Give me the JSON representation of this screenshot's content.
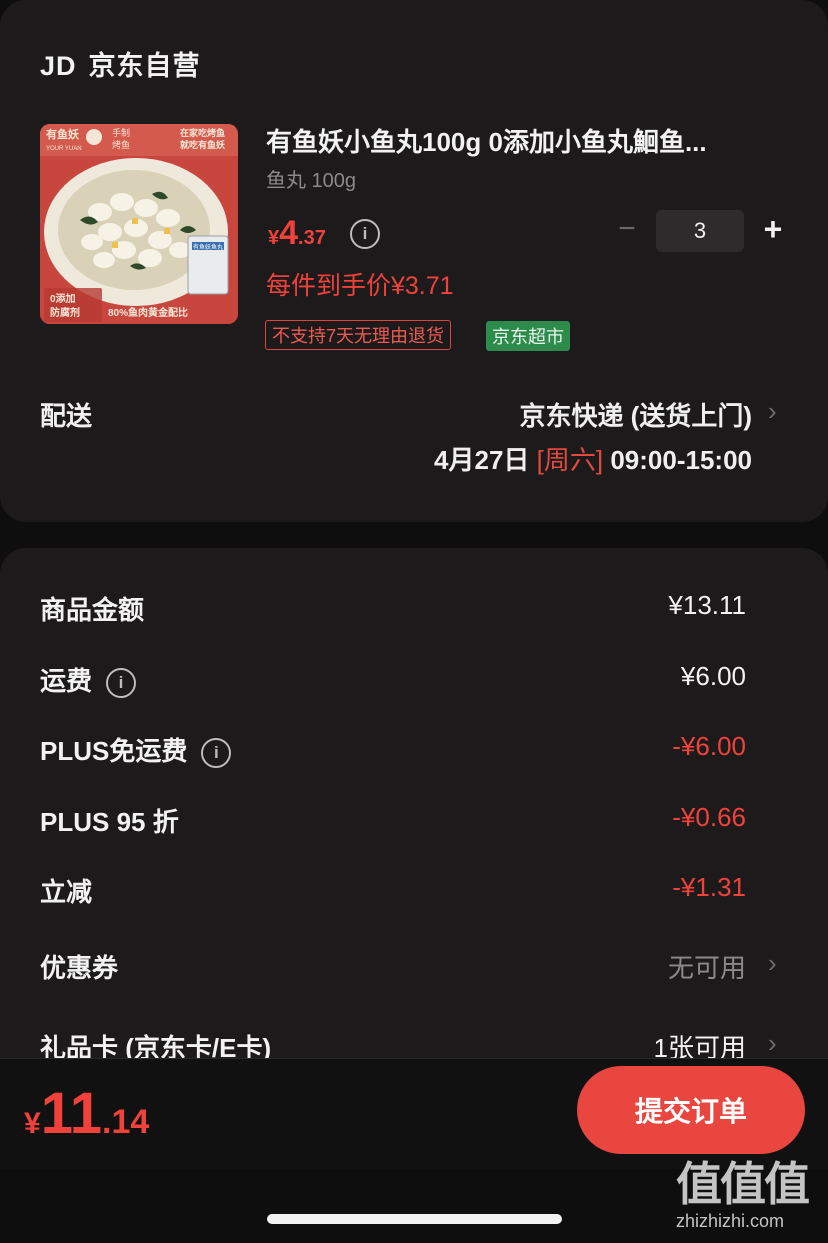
{
  "store": {
    "logo": "JD",
    "name": "京东自营"
  },
  "product": {
    "title": "有鱼妖小鱼丸100g 0添加小鱼丸鮰鱼...",
    "spec": "鱼丸 100g",
    "price_currency": "¥",
    "price_int": "4",
    "price_dec": ".37",
    "quantity": "3",
    "minus": "−",
    "plus": "+",
    "per_unit": "每件到手价¥3.71",
    "tags": {
      "return": "不支持7天无理由退货",
      "market": "京东超市"
    },
    "image_text": {
      "brand": "有鱼妖",
      "sub": "YOUR YUAN",
      "flag1": "手制",
      "flag2": "烤鱼",
      "slogan1": "在家吃烤鱼",
      "slogan2": "就吃有鱼妖",
      "badge1": "0添加",
      "badge2": "防腐剂",
      "footer": "80%鱼肉黄金配比",
      "pack": "有鱼妖鱼丸"
    }
  },
  "shipping": {
    "label": "配送",
    "method": "京东快递 (送货上门)",
    "date": "4月27日",
    "weekday": "[周六]",
    "window": "09:00-15:00"
  },
  "summary": [
    {
      "label": "商品金额",
      "value": "¥13.11"
    },
    {
      "label": "运费",
      "value": "¥6.00"
    },
    {
      "label": "PLUS免运费",
      "value": "-¥6.00"
    },
    {
      "label": "PLUS 95 折",
      "value": "-¥0.66"
    },
    {
      "label": "立减",
      "value": "-¥1.31"
    },
    {
      "label": "优惠券",
      "value": "无可用"
    },
    {
      "label": "礼品卡 (京东卡/E卡)",
      "value": "1张可用"
    }
  ],
  "total": {
    "currency": "¥",
    "int": "11",
    "dec": ".14"
  },
  "submit_label": "提交订单",
  "watermark": {
    "big": "值值值",
    "site": "zhizhizhi.com"
  },
  "colors": {
    "accent": "#f0423a",
    "card": "#1c1a1a",
    "background": "#0f0e0e",
    "tag_green": "#2d8c4b"
  },
  "icons": [
    "info-icon",
    "chevron-right-icon",
    "minus-icon",
    "plus-icon"
  ]
}
